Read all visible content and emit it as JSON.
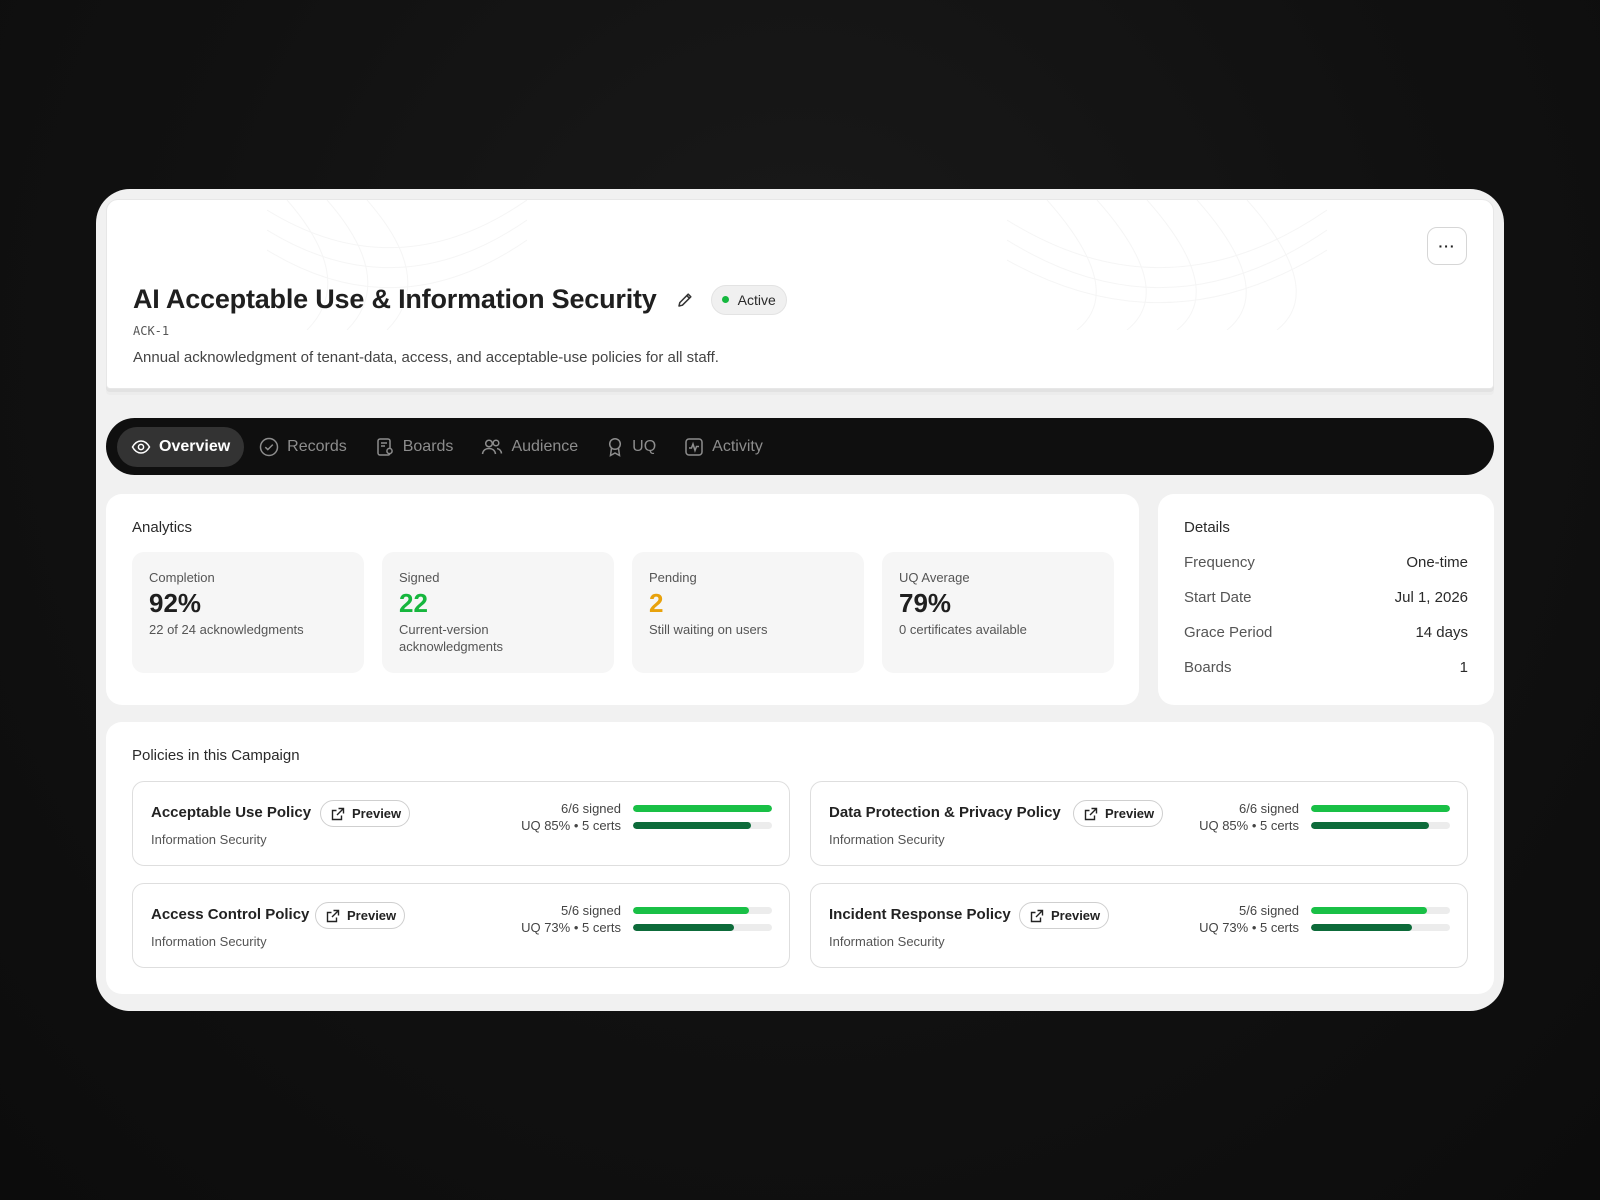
{
  "header": {
    "title": "AI Acceptable Use & Information Security",
    "status": "Active",
    "code": "ACK-1",
    "description": "Annual acknowledgment of tenant-data, access, and acceptable-use policies for all staff.",
    "more_label": "···"
  },
  "tabs": [
    {
      "label": "Overview",
      "icon": "eye-icon",
      "active": true
    },
    {
      "label": "Records",
      "icon": "check-circle-icon"
    },
    {
      "label": "Boards",
      "icon": "board-icon"
    },
    {
      "label": "Audience",
      "icon": "users-icon"
    },
    {
      "label": "UQ",
      "icon": "award-icon"
    },
    {
      "label": "Activity",
      "icon": "activity-icon"
    }
  ],
  "analytics": {
    "title": "Analytics",
    "stats": [
      {
        "label": "Completion",
        "value": "92%",
        "sub": "22 of 24 acknowledgments",
        "color": "#1f1f1f"
      },
      {
        "label": "Signed",
        "value": "22",
        "sub": "Current-version acknowledgments",
        "color": "#16b63d"
      },
      {
        "label": "Pending",
        "value": "2",
        "sub": "Still waiting on users",
        "color": "#e8a20c"
      },
      {
        "label": "UQ Average",
        "value": "79%",
        "sub": "0 certificates available",
        "color": "#1f1f1f"
      }
    ]
  },
  "details": {
    "title": "Details",
    "rows": [
      {
        "key": "Frequency",
        "value": "One-time"
      },
      {
        "key": "Start Date",
        "value": "Jul 1, 2026"
      },
      {
        "key": "Grace Period",
        "value": "14 days"
      },
      {
        "key": "Boards",
        "value": "1"
      }
    ]
  },
  "policies": {
    "title": "Policies in this Campaign",
    "preview_label": "Preview",
    "items": [
      {
        "name": "Acceptable Use Policy",
        "category": "Information Security",
        "signed": "6/6 signed",
        "uq": "UQ 85% • 5 certs",
        "signed_fraction": 1.0,
        "uq_fraction": 0.85
      },
      {
        "name": "Data Protection & Privacy Policy",
        "category": "Information Security",
        "signed": "6/6 signed",
        "uq": "UQ 85% • 5 certs",
        "signed_fraction": 1.0,
        "uq_fraction": 0.85
      },
      {
        "name": "Access Control Policy",
        "category": "Information Security",
        "signed": "5/6 signed",
        "uq": "UQ 73% • 5 certs",
        "signed_fraction": 0.833,
        "uq_fraction": 0.73
      },
      {
        "name": "Incident Response Policy",
        "category": "Information Security",
        "signed": "5/6 signed",
        "uq": "UQ 73% • 5 certs",
        "signed_fraction": 0.833,
        "uq_fraction": 0.73
      }
    ]
  },
  "colors": {
    "signed_bar": "#19c046",
    "uq_bar": "#0d6b3a",
    "active_dot": "#15b83f"
  }
}
